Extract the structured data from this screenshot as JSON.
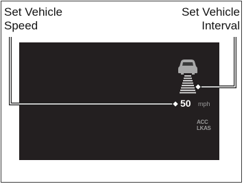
{
  "callouts": {
    "left": {
      "line1": "Set Vehicle",
      "line2": "Speed"
    },
    "right": {
      "line1": "Set Vehicle",
      "line2": "Interval"
    }
  },
  "display": {
    "speed_value": "50",
    "speed_unit": "mph",
    "indicators": [
      "ACC",
      "LKAS"
    ],
    "interval_icon": "vehicle-interval-icon"
  },
  "colors": {
    "screen": "#231f20",
    "leader_line": "#ffffff",
    "text": "#111111",
    "dim_text": "#9a9a9a"
  }
}
